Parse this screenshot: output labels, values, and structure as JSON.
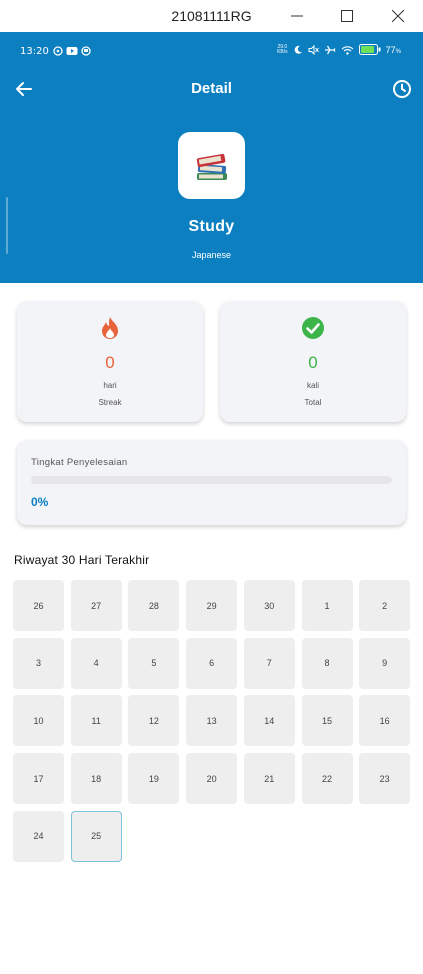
{
  "window": {
    "title": "21081111RG"
  },
  "status_bar": {
    "time": "13:20",
    "left_icons": [
      "whatsapp-icon",
      "youtube-icon",
      "app-icon"
    ],
    "net_speed_top": "29.0",
    "net_speed_bottom": "KB/s",
    "battery_percent": "77"
  },
  "nav": {
    "title": "Detail"
  },
  "habit": {
    "icon": "📚",
    "name": "Study",
    "category": "Japanese"
  },
  "stats": {
    "streak": {
      "value": "0",
      "unit": "hari",
      "label": "Streak",
      "color": "#e8623a"
    },
    "total": {
      "value": "0",
      "unit": "kali",
      "label": "Total",
      "color": "#3cb44a"
    }
  },
  "completion": {
    "title": "Tingkat Penyelesaian",
    "value_text": "0%",
    "fraction": 0
  },
  "history": {
    "title": "Riwayat 30 Hari Terakhir",
    "days": [
      "26",
      "27",
      "28",
      "29",
      "30",
      "1",
      "2",
      "3",
      "4",
      "5",
      "6",
      "7",
      "8",
      "9",
      "10",
      "11",
      "12",
      "13",
      "14",
      "15",
      "16",
      "17",
      "18",
      "19",
      "20",
      "21",
      "22",
      "23",
      "24",
      "25"
    ],
    "today_index": 29
  },
  "colors": {
    "primary": "#0b7fc0",
    "card_bg": "#f3f4f8",
    "day_bg": "#eeeeee",
    "today_border": "#7cc3e0"
  }
}
